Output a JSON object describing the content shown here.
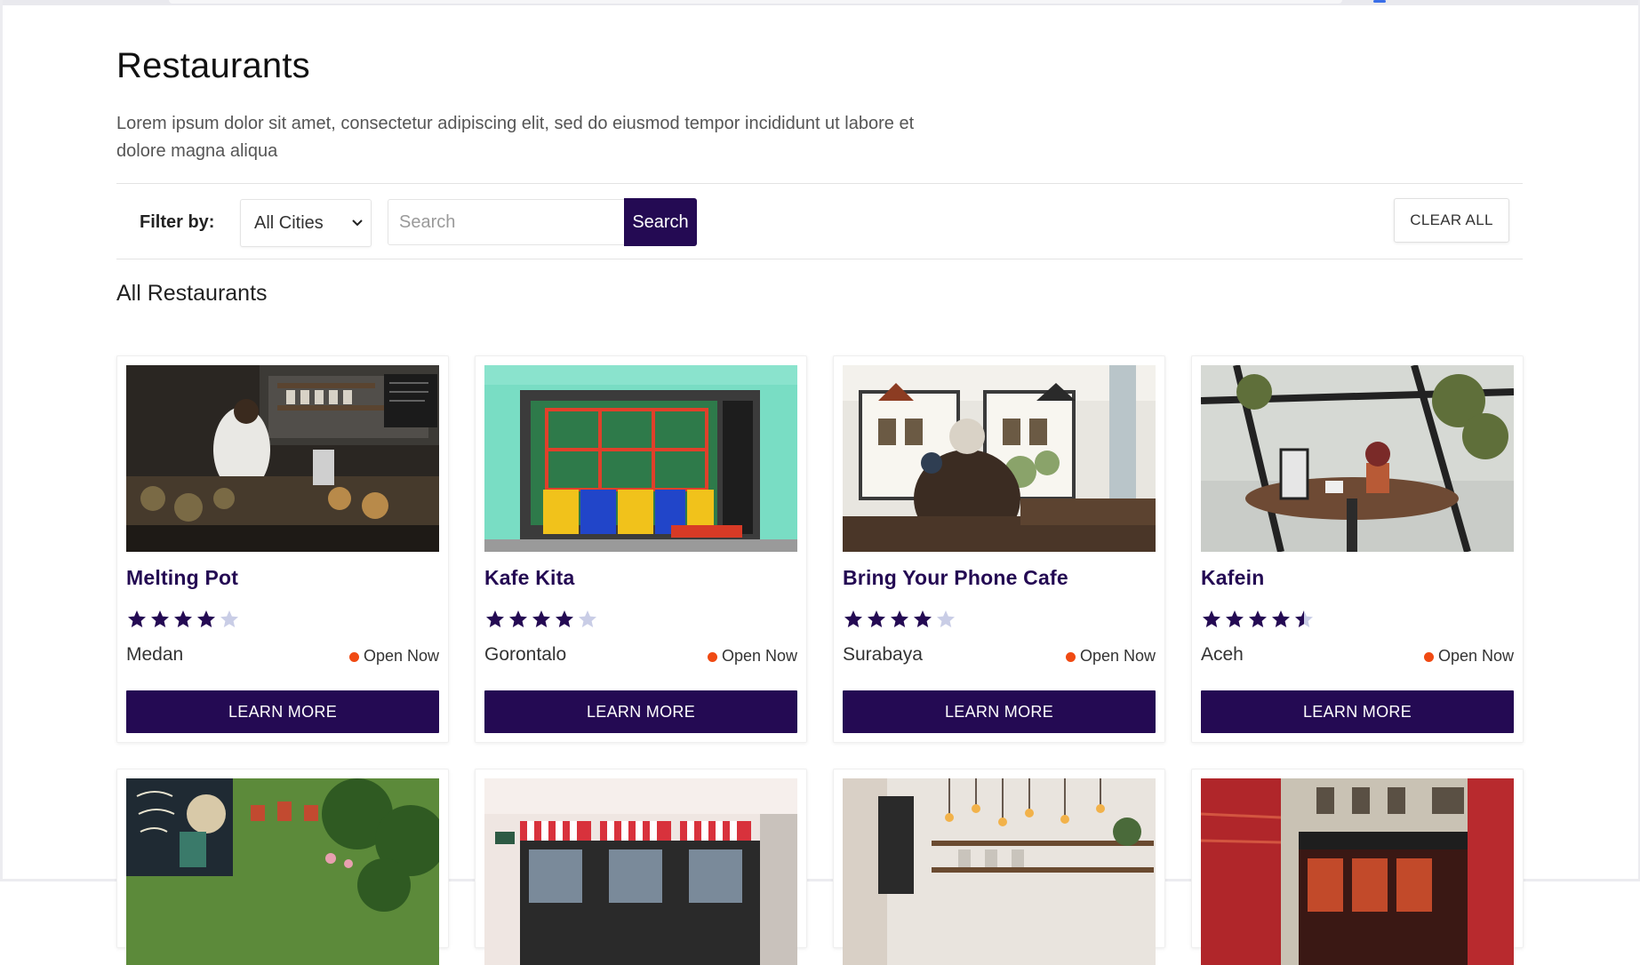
{
  "page": {
    "title": "Restaurants",
    "description": "Lorem ipsum dolor sit amet, consectetur adipiscing elit, sed do eiusmod tempor incididunt ut labore et dolore magna aliqua"
  },
  "filter": {
    "label": "Filter by:",
    "city_selected": "All Cities",
    "search_placeholder": "Search",
    "search_button": "Search",
    "clear_button": "CLEAR ALL"
  },
  "section_title": "All Restaurants",
  "colors": {
    "primary": "#240a53",
    "status_dot": "#f04a13",
    "star_empty": "#c9cde6"
  },
  "restaurants": [
    {
      "name": "Melting Pot",
      "rating": 4,
      "city": "Medan",
      "status": "Open Now",
      "button": "LEARN MORE",
      "image_icon": "kitchen-photo"
    },
    {
      "name": "Kafe Kita",
      "rating": 4,
      "city": "Gorontalo",
      "status": "Open Now",
      "button": "LEARN MORE",
      "image_icon": "storefront-photo"
    },
    {
      "name": "Bring Your Phone Cafe",
      "rating": 4,
      "city": "Surabaya",
      "status": "Open Now",
      "button": "LEARN MORE",
      "image_icon": "cafe-interior-photo"
    },
    {
      "name": "Kafein",
      "rating": 4.5,
      "city": "Aceh",
      "status": "Open Now",
      "button": "LEARN MORE",
      "image_icon": "table-photo"
    }
  ],
  "more_cards": [
    {
      "image_icon": "garden-cafe-photo"
    },
    {
      "image_icon": "awning-shop-photo"
    },
    {
      "image_icon": "hanging-lights-photo"
    },
    {
      "image_icon": "london-street-photo"
    }
  ]
}
